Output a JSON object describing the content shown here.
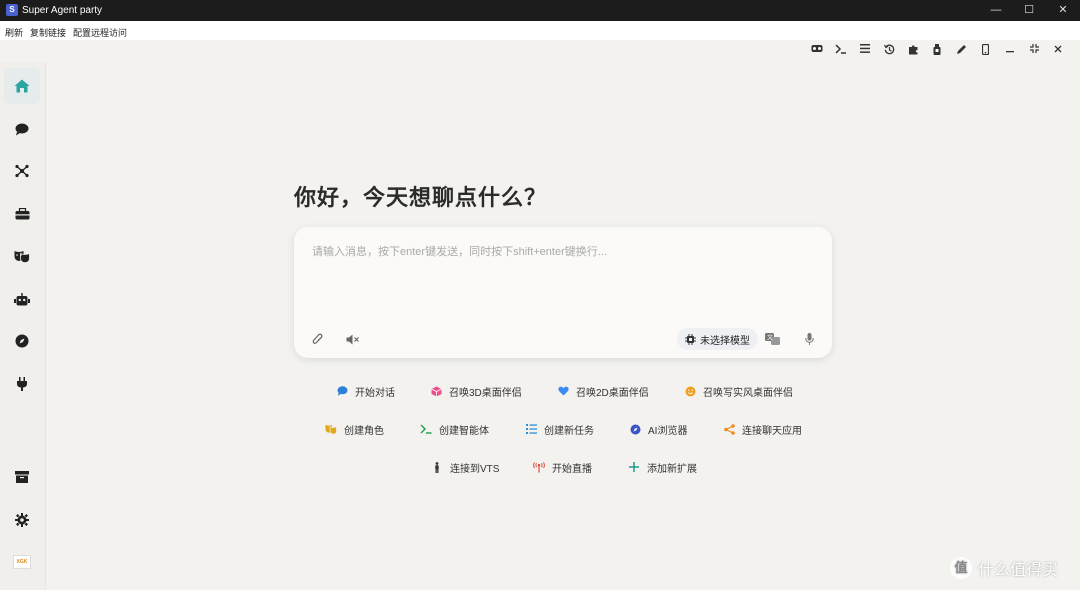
{
  "window": {
    "title": "Super Agent party",
    "app_icon": "S"
  },
  "window_controls": {
    "minimize": "—",
    "maximize": "☐",
    "close": "✕"
  },
  "menu": [
    "刷新",
    "复制链接",
    "配置远程访问"
  ],
  "toolbar_icons": [
    "vr-headset-icon",
    "terminal-icon",
    "list-icon",
    "history-icon",
    "puzzle-icon",
    "usb-icon",
    "pen-icon",
    "mobile-icon",
    "minus-icon",
    "compress-icon",
    "close-icon"
  ],
  "sidebar": {
    "items": [
      "home-icon",
      "chat-icon",
      "network-icon",
      "toolbox-icon",
      "masks-icon",
      "robot-icon",
      "compass-icon",
      "plug-icon"
    ],
    "bottom": [
      "archive-icon",
      "settings-icon",
      "logo-icon"
    ],
    "logo_text": "XGK"
  },
  "main": {
    "heading": "你好，今天想聊点什么？",
    "input_placeholder": "请输入消息，按下enter键发送，同时按下shift+enter键换行...",
    "model_label": "未选择模型"
  },
  "actions": [
    {
      "label": "开始对话",
      "icon": "speech-bubble-icon",
      "color": "#2f7fd6"
    },
    {
      "label": "召唤3D桌面伴侣",
      "icon": "cube-icon",
      "color": "#ec4f8a"
    },
    {
      "label": "召唤2D桌面伴侣",
      "icon": "heart-icon",
      "color": "#3a8cf0"
    },
    {
      "label": "召唤写实风桌面伴侣",
      "icon": "smile-icon",
      "color": "#f0a020"
    },
    {
      "label": "创建角色",
      "icon": "masks-icon",
      "color": "#e0a81a"
    },
    {
      "label": "创建智能体",
      "icon": "terminal-icon",
      "color": "#29a35a"
    },
    {
      "label": "创建新任务",
      "icon": "task-list-icon",
      "color": "#2c8fd8"
    },
    {
      "label": "AI浏览器",
      "icon": "compass-icon",
      "color": "#3a54c8"
    },
    {
      "label": "连接聊天应用",
      "icon": "share-icon",
      "color": "#f08a1c"
    },
    {
      "label": "连接到VTS",
      "icon": "person-icon",
      "color": "#333333"
    },
    {
      "label": "开始直播",
      "icon": "broadcast-icon",
      "color": "#e0402a"
    },
    {
      "label": "添加新扩展",
      "icon": "plus-icon",
      "color": "#1f9a8a"
    }
  ],
  "watermark": {
    "text": "什么值得买",
    "badge": "值"
  }
}
